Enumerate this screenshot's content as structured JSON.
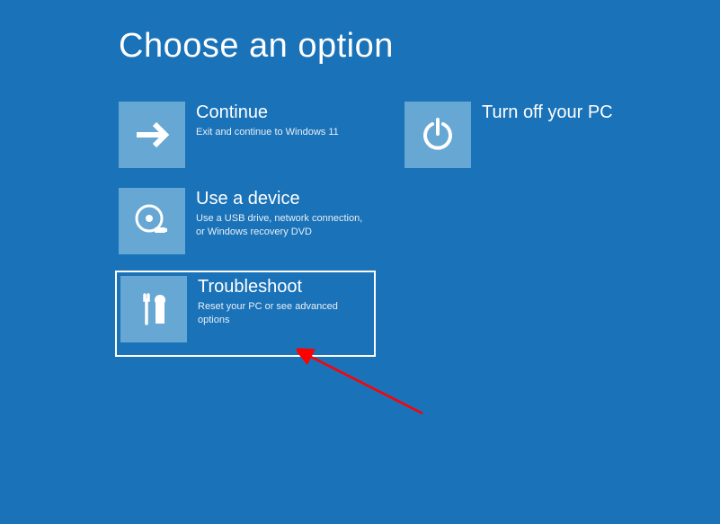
{
  "title": "Choose an option",
  "colors": {
    "background": "#1a72b8",
    "tile_bg": "#66a7d4",
    "text": "#ffffff"
  },
  "options": {
    "continue": {
      "title": "Continue",
      "subtitle": "Exit and continue to Windows 11",
      "icon": "arrow-right"
    },
    "turn_off": {
      "title": "Turn off your PC",
      "subtitle": "",
      "icon": "power"
    },
    "use_device": {
      "title": "Use a device",
      "subtitle": "Use a USB drive, network connection, or Windows recovery DVD",
      "icon": "disc-usb"
    },
    "troubleshoot": {
      "title": "Troubleshoot",
      "subtitle": "Reset your PC or see advanced options",
      "icon": "tools",
      "selected": true
    }
  }
}
